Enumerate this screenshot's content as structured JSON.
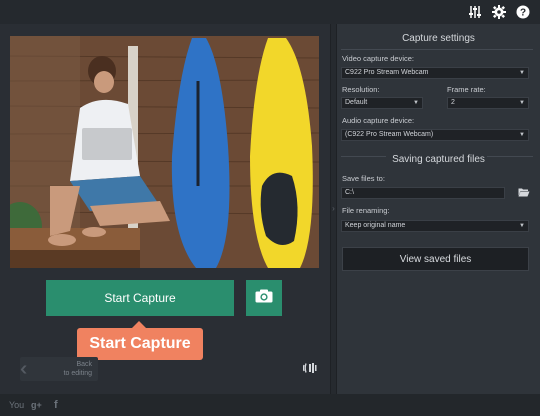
{
  "toolbar": {
    "icons": [
      "equalizer-icon",
      "gear-icon",
      "help-icon"
    ]
  },
  "preview": {
    "description_icon": "camera-preview"
  },
  "controls": {
    "start_label": "Start Capture",
    "snapshot_icon": "camera-icon",
    "callout_label": "Start Capture",
    "back_label_line1": "Back",
    "back_label_line2": "to editing"
  },
  "capture_settings": {
    "title": "Capture settings",
    "video_label": "Video capture device:",
    "video_value": "C922 Pro Stream Webcam",
    "resolution_label": "Resolution:",
    "resolution_value": "Default",
    "framerate_label": "Frame rate:",
    "framerate_value": "2",
    "audio_label": "Audio capture device:",
    "audio_value": "(C922 Pro Stream Webcam)"
  },
  "saving": {
    "title": "Saving captured files",
    "save_label": "Save files to:",
    "save_path": "C:\\",
    "renaming_label": "File renaming:",
    "renaming_value": "Keep original name",
    "view_button": "View saved files"
  },
  "social": {
    "youtube": "You",
    "gplus": "g+",
    "facebook": "f"
  },
  "colors": {
    "accent": "#2a8e6e",
    "callout": "#f08260",
    "panel": "#2f343a",
    "background": "#2a2e34"
  }
}
